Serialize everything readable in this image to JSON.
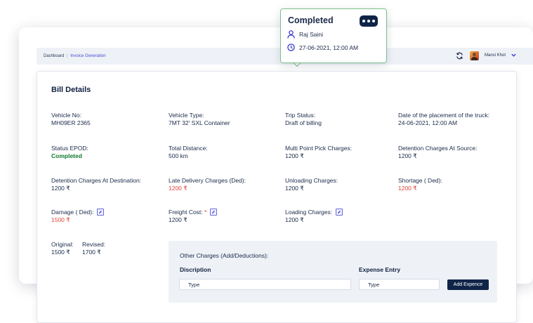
{
  "breadcrumb": {
    "root": "Dashboard",
    "separator": "|",
    "current": "Invoice Generation"
  },
  "user": {
    "name": "Mansi Khot"
  },
  "bill": {
    "title": "Bill Details",
    "fields": [
      {
        "label": "Vehicle No:",
        "value": "MH09ER 2365"
      },
      {
        "label": "Vehicle Type:",
        "value": "7MT 32' SXL Container"
      },
      {
        "label": "Trip Status:",
        "value": "Draft of billing"
      },
      {
        "label": "Date of the placement of the truck:",
        "value": "24-06-2021, 12:00 AM"
      },
      {
        "label": "Status EPOD:",
        "value": "Completed"
      },
      {
        "label": "Total Distance:",
        "value": "500 km"
      },
      {
        "label": "Multi Point Pick Charges:",
        "value": "1200 ₹"
      },
      {
        "label": "Detention Charges At Source:",
        "value": "1200 ₹"
      },
      {
        "label": "Detention Charges At Destination:",
        "value": "1200 ₹"
      },
      {
        "label": "Late Delivery Charges (Ded):",
        "value": "1200 ₹"
      },
      {
        "label": "Unloading Charges:",
        "value": "1200 ₹"
      },
      {
        "label": "Shortage ( Ded):",
        "value": "1200 ₹"
      },
      {
        "label": "Damage ( Ded):",
        "value": "1500 ₹"
      },
      {
        "label": "Freight Cost:",
        "required": "*",
        "value": "1200 ₹"
      },
      {
        "label": "Loading Charges:",
        "value": "1200 ₹"
      }
    ],
    "original": {
      "label": "Original:",
      "value": "1500 ₹"
    },
    "revised": {
      "label": "Revised:",
      "value": "1700 ₹"
    }
  },
  "other_charges": {
    "title": "Other Charges (Add/Deductions):",
    "description_header": "Discription",
    "expense_header": "Expense Entry",
    "description_placeholder": "Type",
    "expense_placeholder": "Type",
    "add_button": "Add Expence"
  },
  "popover": {
    "status": "Completed",
    "person": "Raj Saini",
    "datetime": "27-06-2021, 12:00 AM"
  },
  "colors": {
    "navy": "#0f2447",
    "completed_green": "#0f7a2c",
    "deduction_red": "#e0463a",
    "accent": "#4a4ad6",
    "popover_border": "#7bc08a"
  },
  "icons": [
    "refresh-icon",
    "chevron-down-icon",
    "edit-icon",
    "user-icon",
    "clock-icon",
    "more-icon"
  ]
}
